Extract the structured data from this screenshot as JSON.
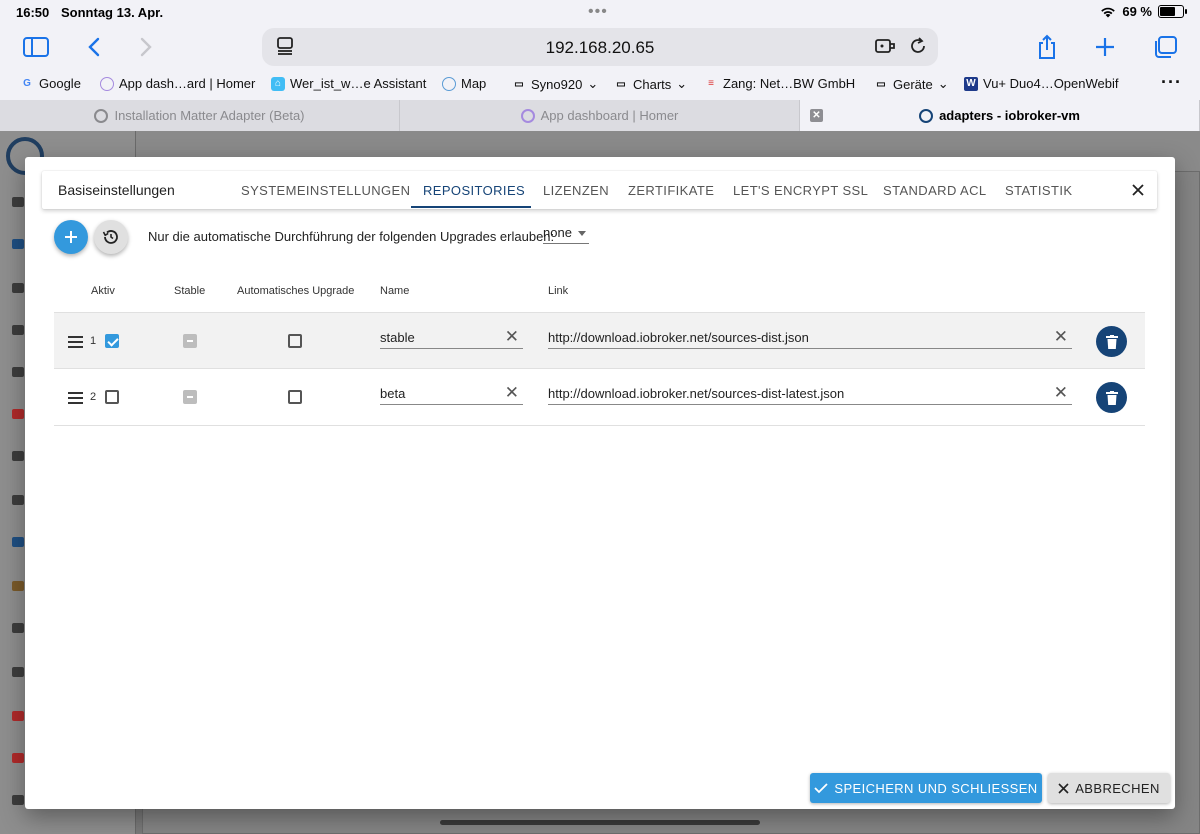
{
  "status": {
    "time": "16:50",
    "date": "Sonntag 13. Apr.",
    "battery": "69 %",
    "battery_level": 0.69
  },
  "browser": {
    "url": "192.168.20.65",
    "bookmarks": [
      "Google",
      "App dash…ard | Homer",
      "Wer_ist_w…e Assistant",
      "Map",
      "Syno920",
      "Charts",
      "Zang: Net…BW GmbH",
      "Geräte",
      "Vu+ Duo4…OpenWebif"
    ],
    "tabs": [
      "Installation Matter Adapter (Beta)",
      "App dashboard | Homer",
      "adapters - iobroker-vm"
    ]
  },
  "dialog": {
    "title": "Basiseinstellungen",
    "tabs": [
      "SYSTEMEINSTELLUNGEN",
      "REPOSITORIES",
      "LIZENZEN",
      "ZERTIFIKATE",
      "LET'S ENCRYPT SSL",
      "STANDARD ACL",
      "STATISTIK"
    ],
    "active_tab": "REPOSITORIES",
    "restrict_label": "Nur die automatische Durchführung der folgenden Upgrades erlauben:",
    "restrict_value": "none",
    "columns": [
      "Aktiv",
      "Stable",
      "Automatisches Upgrade",
      "Name",
      "Link"
    ],
    "rows": [
      {
        "index": "1",
        "active": true,
        "stable": false,
        "auto_upgrade": false,
        "name": "stable",
        "link": "http://download.iobroker.net/sources-dist.json"
      },
      {
        "index": "2",
        "active": false,
        "stable": false,
        "auto_upgrade": false,
        "name": "beta",
        "link": "http://download.iobroker.net/sources-dist-latest.json"
      }
    ],
    "save_label": "SPEICHERN UND SCHLIESSEN",
    "cancel_label": "ABBRECHEN"
  },
  "colors": {
    "primary": "#164477",
    "accent": "#3399dd"
  }
}
